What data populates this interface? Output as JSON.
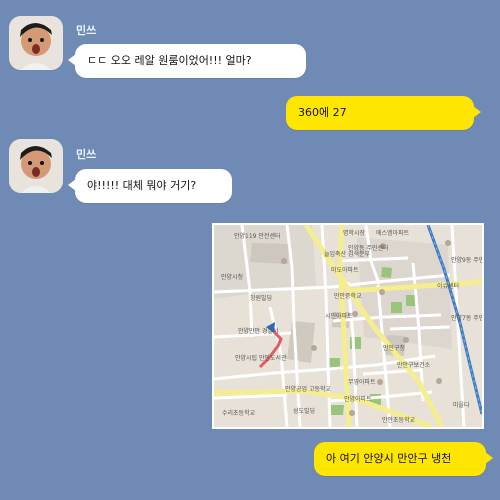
{
  "chat": {
    "sender_name": "민쓰",
    "messages": [
      {
        "from": "other",
        "text": "ㄷㄷ 오오 레알 원룸이었어!!! 얼마?"
      },
      {
        "from": "me",
        "text": "360에 27"
      },
      {
        "from": "other",
        "text": "야!!!!! 대체 뭐야 거기?"
      },
      {
        "from": "me",
        "type": "image",
        "alt": "map"
      },
      {
        "from": "me",
        "text": "아 여기 안양시 만안구 냉천"
      }
    ]
  },
  "map": {
    "labels": [
      "안양119 안전센터",
      "늘임축산 검색분부",
      "안양시청",
      "창원빌딩",
      "안양만안 경찰서",
      "안양시립 만안도서관",
      "안양공업 고등학교",
      "수리초등학교",
      "성도빌딩",
      "시민아파트",
      "만안구청",
      "만안구보건소",
      "무영아파트",
      "안양아파트",
      "만안초등학교",
      "안양9동 주민센터",
      "안양7동 주민센터",
      "이슈센터",
      "에스엠아파트",
      "명학시장",
      "인양동 주민센터",
      "미도아파트",
      "만안중학교",
      "마을다"
    ]
  }
}
